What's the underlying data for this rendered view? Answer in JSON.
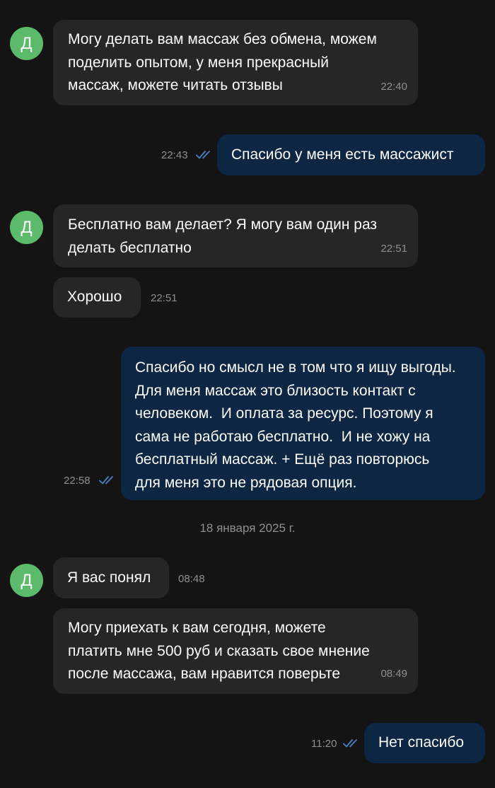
{
  "messages": [
    {
      "author_initial": "Д",
      "text": "Могу делать вам массаж без обмена, можем\nподелить опытом, у меня прекрасный\nмассаж, можете читать отзывы",
      "time": "22:40"
    },
    {
      "text": "Спасибо у меня есть массажист",
      "time": "22:43",
      "status": "read"
    },
    {
      "author_initial": "Д",
      "text": "Бесплатно вам делает? Я могу вам один раз\nделать бесплатно",
      "time": "22:51"
    },
    {
      "text": "Хорошо",
      "time": "22:51"
    },
    {
      "text": "Спасибо но смысл не в том что я ищу выгоды.\nДля меня массаж это близость контакт с\nчеловеком.  И оплата за ресурс. Поэтому я\nсама не работаю бесплатно.  И не хожу на\nбесплатный массаж. + Ещё раз повторюсь\nдля меня это не рядовая опция.",
      "time": "22:58",
      "status": "read"
    },
    {
      "author_initial": "Д",
      "text": "Я вас понял",
      "time": "08:48"
    },
    {
      "text": "Могу приехать к вам сегодня, можете\nплатить мне 500 руб и сказать свое мнение\nпосле массажа, вам нравится поверьте",
      "time": "08:49"
    },
    {
      "text": "Нет спасибо",
      "time": "11:20",
      "status": "read"
    }
  ],
  "date_separator": "18 января 2025 г.",
  "colors": {
    "background": "#141414",
    "incoming_bubble": "#262626",
    "outgoing_bubble": "#0d2644",
    "avatar": "#5cbb6a",
    "timestamp": "#8f8f8f",
    "read_check": "#4a7fc8"
  },
  "icons": {
    "read_status": "double-check-icon"
  }
}
